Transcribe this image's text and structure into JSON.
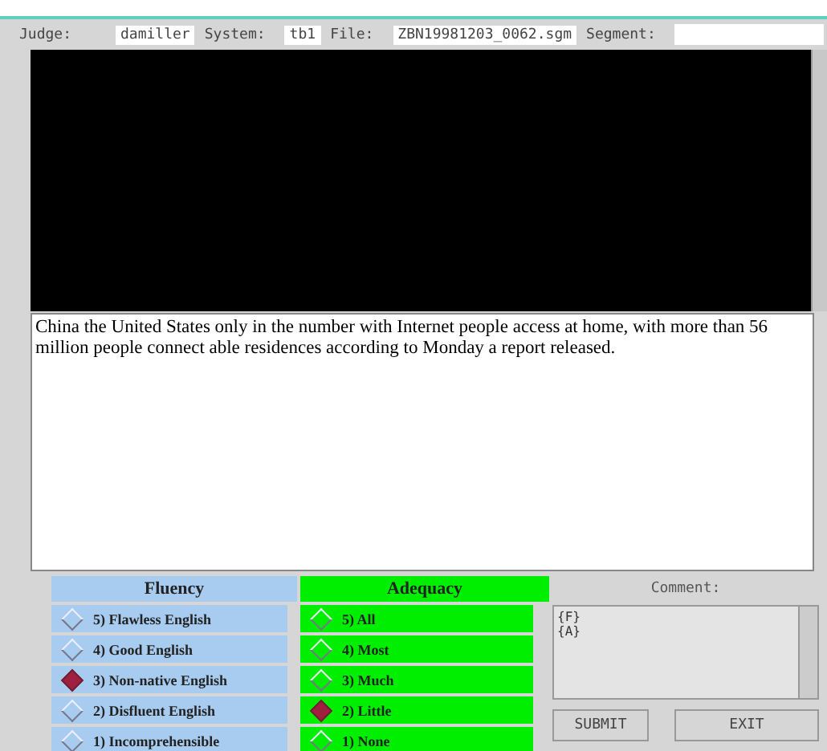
{
  "header": {
    "fields": [
      {
        "label": "Judge:",
        "value": "damiller"
      },
      {
        "label": "System:",
        "value": "tb1"
      },
      {
        "label": "File:",
        "value": "ZBN19981203_0062.sgm"
      },
      {
        "label": "Segment:"
      }
    ]
  },
  "translation": {
    "text": "China the United States only in the number with Internet people access at home, with more than 56 million people connect able residences according to Monday a report released."
  },
  "fluency": {
    "title": "Fluency",
    "options": [
      {
        "label": "5) Flawless English",
        "selected": false
      },
      {
        "label": "4) Good English",
        "selected": false
      },
      {
        "label": "3) Non-native English",
        "selected": true
      },
      {
        "label": "2) Disfluent English",
        "selected": false
      },
      {
        "label": "1) Incomprehensible",
        "selected": false
      }
    ]
  },
  "adequacy": {
    "title": "Adequacy",
    "options": [
      {
        "label": "5) All",
        "selected": false
      },
      {
        "label": "4) Most",
        "selected": false
      },
      {
        "label": "3) Much",
        "selected": false
      },
      {
        "label": "2) Little",
        "selected": true
      },
      {
        "label": "1) None",
        "selected": false
      }
    ]
  },
  "comment": {
    "label": "Comment:",
    "lines": [
      "{F}",
      "{A}"
    ]
  },
  "buttons": [
    "SUBMIT",
    "EXIT"
  ]
}
